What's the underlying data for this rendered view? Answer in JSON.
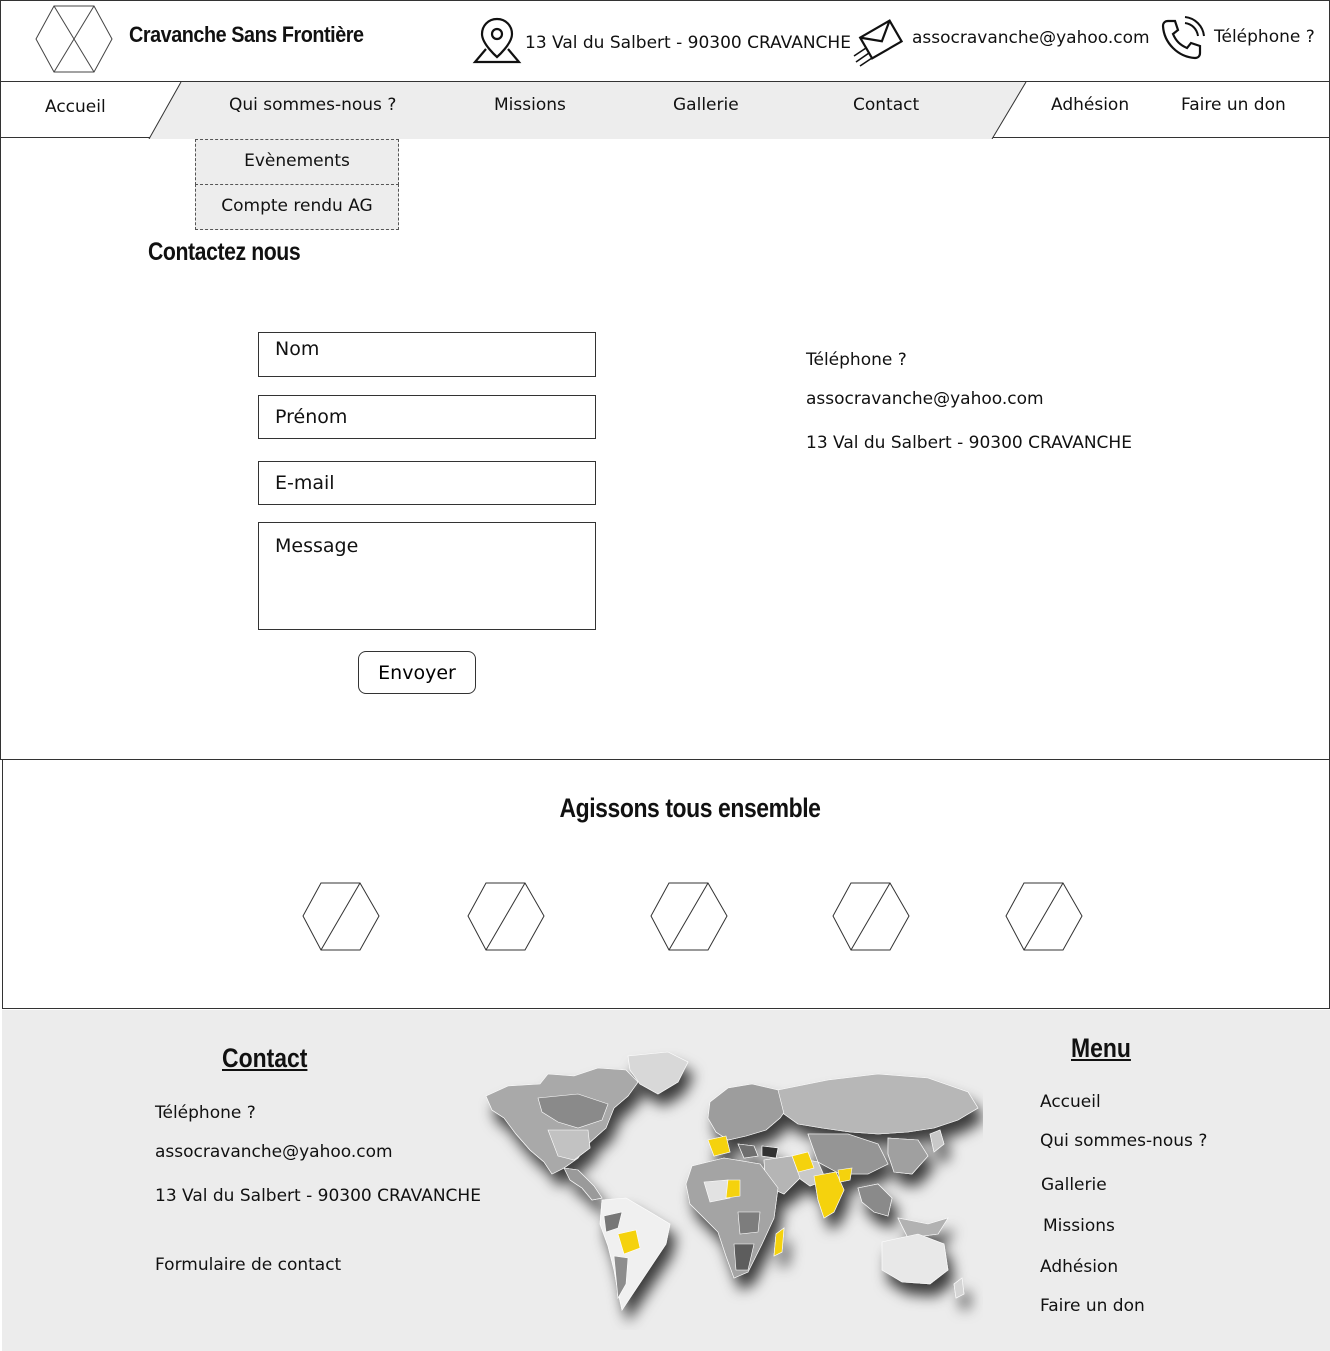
{
  "header": {
    "site_title": "Cravanche Sans Frontière",
    "address": "13 Val du Salbert - 90300 CRAVANCHE",
    "email": "assocravanche@yahoo.com",
    "phone": "Téléphone ?",
    "icons": [
      "logo-placeholder-icon",
      "map-pin-icon",
      "envelope-icon",
      "phone-icon"
    ]
  },
  "nav": {
    "items": [
      "Accueil",
      "Qui sommes-nous ?",
      "Missions",
      "Gallerie",
      "Contact",
      "Adhésion",
      "Faire un don"
    ],
    "dropdown": [
      "Evènements",
      "Compte rendu AG"
    ]
  },
  "contact": {
    "title": "Contactez nous",
    "form": {
      "name_placeholder": "Nom",
      "firstname_placeholder": "Prénom",
      "email_placeholder": "E-mail",
      "message_placeholder": "Message",
      "submit_label": "Envoyer"
    },
    "info": {
      "phone": "Téléphone ?",
      "email": "assocravanche@yahoo.com",
      "address": "13 Val du Salbert - 90300 CRAVANCHE"
    }
  },
  "partners": {
    "title": "Agissons tous ensemble",
    "logos": [
      "partner-logo-icon",
      "partner-logo-icon",
      "partner-logo-icon",
      "partner-logo-icon",
      "partner-logo-icon"
    ]
  },
  "footer": {
    "contact_heading": "Contact",
    "phone": "Téléphone ?",
    "email": "assocravanche@yahoo.com",
    "address": "13 Val du Salbert - 90300 CRAVANCHE",
    "form_link": "Formulaire de contact",
    "menu_heading": "Menu",
    "menu_items": [
      "Accueil",
      "Qui sommes-nous ?",
      "Gallerie",
      "Missions",
      "Adhésion",
      "Faire un don"
    ],
    "map": "world-map-icon"
  },
  "colors": {
    "nav_band": "#ededed",
    "footer_bg": "#ececec",
    "map_highlight": "#f5d20a",
    "map_land": "#a8a8a8"
  }
}
